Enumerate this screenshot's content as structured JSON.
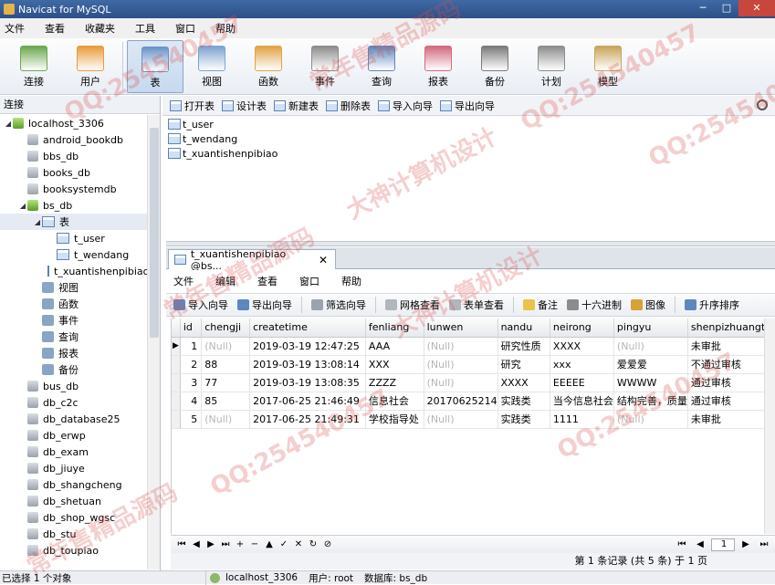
{
  "window": {
    "title": "Navicat for MySQL"
  },
  "menu": [
    "文件",
    "查看",
    "收藏夹",
    "工具",
    "窗口",
    "帮助"
  ],
  "toolbar": [
    {
      "label": "连接",
      "icon": "connection-icon",
      "color": "#6aa84f"
    },
    {
      "label": "用户",
      "icon": "user-icon",
      "color": "#e89c3c"
    },
    {
      "label": "表",
      "icon": "table-icon",
      "color": "#6a93c8",
      "active": true
    },
    {
      "label": "视图",
      "icon": "view-icon",
      "color": "#7da3cf"
    },
    {
      "label": "函数",
      "icon": "function-icon",
      "color": "#e0a347"
    },
    {
      "label": "事件",
      "icon": "event-icon",
      "color": "#8c8c8c"
    },
    {
      "label": "查询",
      "icon": "query-icon",
      "color": "#5f87bd"
    },
    {
      "label": "报表",
      "icon": "report-icon",
      "color": "#d26a7e"
    },
    {
      "label": "备份",
      "icon": "backup-icon",
      "color": "#7a7a7a"
    },
    {
      "label": "计划",
      "icon": "schedule-icon",
      "color": "#8c8c8c"
    },
    {
      "label": "模型",
      "icon": "model-icon",
      "color": "#c9a45b"
    }
  ],
  "left": {
    "header": "连接",
    "tree": [
      {
        "label": "localhost_3306",
        "level": 0,
        "exp": "◢",
        "type": "conn"
      },
      {
        "label": "android_bookdb",
        "level": 1,
        "type": "db"
      },
      {
        "label": "bbs_db",
        "level": 1,
        "type": "db"
      },
      {
        "label": "books_db",
        "level": 1,
        "type": "db"
      },
      {
        "label": "booksystemdb",
        "level": 1,
        "type": "db"
      },
      {
        "label": "bs_db",
        "level": 1,
        "exp": "◢",
        "type": "dbopen"
      },
      {
        "label": "表",
        "level": 2,
        "exp": "◢",
        "type": "tables",
        "sel": true
      },
      {
        "label": "t_user",
        "level": 3,
        "type": "table"
      },
      {
        "label": "t_wendang",
        "level": 3,
        "type": "table"
      },
      {
        "label": "t_xuantishenpibiao",
        "level": 3,
        "type": "table"
      },
      {
        "label": "视图",
        "level": 2,
        "type": "group"
      },
      {
        "label": "函数",
        "level": 2,
        "type": "group"
      },
      {
        "label": "事件",
        "level": 2,
        "type": "group"
      },
      {
        "label": "查询",
        "level": 2,
        "type": "group"
      },
      {
        "label": "报表",
        "level": 2,
        "type": "group"
      },
      {
        "label": "备份",
        "level": 2,
        "type": "group"
      },
      {
        "label": "bus_db",
        "level": 1,
        "type": "db"
      },
      {
        "label": "db_c2c",
        "level": 1,
        "type": "db"
      },
      {
        "label": "db_database25",
        "level": 1,
        "type": "db"
      },
      {
        "label": "db_erwp",
        "level": 1,
        "type": "db"
      },
      {
        "label": "db_exam",
        "level": 1,
        "type": "db"
      },
      {
        "label": "db_jiuye",
        "level": 1,
        "type": "db"
      },
      {
        "label": "db_shangcheng",
        "level": 1,
        "type": "db"
      },
      {
        "label": "db_shetuan",
        "level": 1,
        "type": "db"
      },
      {
        "label": "db_shop_wgsc",
        "level": 1,
        "type": "db"
      },
      {
        "label": "db_stu",
        "level": 1,
        "type": "db"
      },
      {
        "label": "db_toupiao",
        "level": 1,
        "type": "db"
      }
    ]
  },
  "objtoolbar": [
    "打开表",
    "设计表",
    "新建表",
    "删除表",
    "导入向导",
    "导出向导"
  ],
  "objects": [
    "t_user",
    "t_wendang",
    "t_xuantishenpibiao"
  ],
  "tab": {
    "label": "t_xuantishenpibiao @bs...",
    "close": "✕"
  },
  "submenu": [
    "文件",
    "编辑",
    "查看",
    "窗口",
    "帮助"
  ],
  "subtool": [
    {
      "label": "导入向导",
      "color": "#5f87bd"
    },
    {
      "label": "导出向导",
      "color": "#5f87bd"
    },
    {
      "label": "筛选向导",
      "color": "#9aa3ae"
    },
    {
      "label": "网格查看",
      "color": "#b0b6be"
    },
    {
      "label": "表单查看",
      "color": "#b0b6be"
    },
    {
      "label": "备注",
      "color": "#e8c54a"
    },
    {
      "label": "十六进制",
      "color": "#8c8c8c"
    },
    {
      "label": "图像",
      "color": "#d6a23a"
    },
    {
      "label": "升序排序",
      "color": "#5f87bd"
    }
  ],
  "grid": {
    "columns": [
      "id",
      "chengji",
      "createtime",
      "fenliang",
      "lunwen",
      "nandu",
      "neirong",
      "pingyu",
      "shenpizhuangtai"
    ],
    "rows": [
      {
        "ind": "▶",
        "cells": [
          "1",
          "(Null)",
          "2019-03-19 12:47:25",
          "AAA",
          "(Null)",
          "研究性质",
          "XXXX",
          "(Null)",
          "未审批"
        ]
      },
      {
        "ind": "",
        "cells": [
          "2",
          "88",
          "2019-03-19 13:08:14",
          "XXX",
          "(Null)",
          "研究",
          "xxx",
          "爱爱爱",
          "不通过审核"
        ]
      },
      {
        "ind": "",
        "cells": [
          "3",
          "77",
          "2019-03-19 13:08:35",
          "ZZZZ",
          "(Null)",
          "XXXX",
          "EEEEE",
          "WWWW",
          "通过审核"
        ]
      },
      {
        "ind": "",
        "cells": [
          "4",
          "85",
          "2017-06-25 21:46:49",
          "信息社会",
          "20170625214",
          "实践类",
          "当今信息社会",
          "结构完善，质量",
          "通过审核"
        ]
      },
      {
        "ind": "",
        "cells": [
          "5",
          "(Null)",
          "2017-06-25 21:49:31",
          "学校指导处",
          "(Null)",
          "实践类",
          "1111",
          "(Null)",
          "未审批"
        ]
      }
    ]
  },
  "nav": {
    "buttons": [
      "⏮",
      "◀",
      "▶",
      "⏭",
      "+",
      "−",
      "▲",
      "✓",
      "✕",
      "↻",
      "⊘"
    ],
    "page": "1",
    "right": [
      "⏮",
      "◀",
      "▶",
      "⏭"
    ]
  },
  "recinfo": "第 1 条记录 (共 5 条) 于 1 页",
  "status": {
    "left": "已选择 1 个对象",
    "conn": "localhost_3306",
    "user": "用户: root",
    "db": "数据库: bs_db"
  },
  "watermarks": [
    "QQ:254540457",
    "常年售精品源码",
    "大神计算机设计",
    "QQ:254540457",
    "QQ:254540457",
    "常年售精品源码",
    "大神计算机设计",
    "QQ:254540457",
    "QQ:254540457",
    "常年售精品源码"
  ]
}
